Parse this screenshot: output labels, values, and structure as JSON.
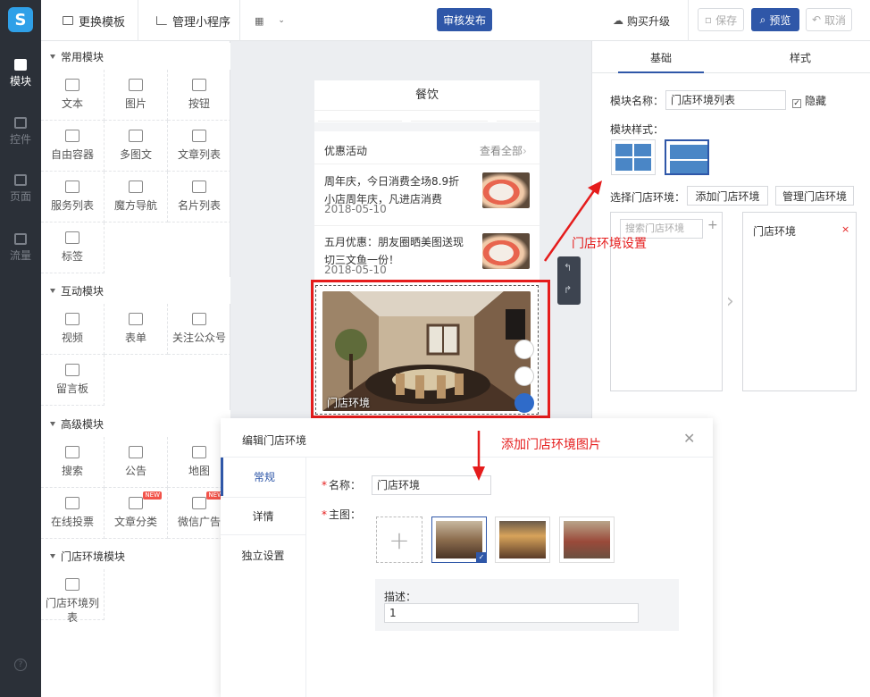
{
  "nav": {
    "logo": "S",
    "items": [
      {
        "label": "模块",
        "icon": "module-icon"
      },
      {
        "label": "控件",
        "icon": "widget-icon"
      },
      {
        "label": "页面",
        "icon": "page-icon"
      },
      {
        "label": "流量",
        "icon": "traffic-icon"
      }
    ],
    "help": "?"
  },
  "topbar": {
    "change_template": "更换模板",
    "manage_miniprogram": "管理小程序",
    "publish": "审核发布",
    "buy_upgrade": "购买升级",
    "save": "保存",
    "preview": "预览",
    "cancel": "取消"
  },
  "modules": {
    "sections": [
      {
        "title": "常用模块",
        "items": [
          "文本",
          "图片",
          "按钮",
          "自由容器",
          "多图文",
          "文章列表",
          "服务列表",
          "魔方导航",
          "名片列表",
          "标签"
        ]
      },
      {
        "title": "互动模块",
        "items": [
          "视频",
          "表单",
          "关注公众号",
          "留言板"
        ]
      },
      {
        "title": "高级模块",
        "items": [
          "搜索",
          "公告",
          "地图",
          "在线投票",
          "文章分类",
          "微信广告"
        ]
      },
      {
        "title": "门店环境模块",
        "items": [
          "门店环境列表"
        ]
      }
    ],
    "new_badge": "NEW"
  },
  "phone": {
    "title": "餐饮",
    "promo_title": "优惠活动",
    "promo_more": "查看全部",
    "news": [
      {
        "title": "周年庆，今日消费全场8.9折 小店周年庆，凡进店消费",
        "date": "2018-05-10"
      },
      {
        "title": "五月优惠：朋友圈晒美图送现切三文鱼一份！",
        "date": "2018-05-10"
      }
    ],
    "env_caption": "门店环境"
  },
  "right": {
    "tabs": [
      "基础",
      "样式"
    ],
    "module_name_label": "模块名称：",
    "module_name_value": "门店环境列表",
    "hide_label": "隐藏",
    "module_style_label": "模块样式：",
    "select_env_label": "选择门店环境：",
    "add_env": "添加门店环境",
    "manage_env": "管理门店环境",
    "search_placeholder": "搜索门店环境",
    "selected_item": "门店环境"
  },
  "annotations": {
    "env_setting": "门店环境设置",
    "add_image": "添加门店环境图片"
  },
  "modal": {
    "title": "编辑门店环境",
    "tabs": [
      "常规",
      "详情",
      "独立设置"
    ],
    "name_label": "名称：",
    "name_value": "门店环境",
    "main_image_label": "主图：",
    "desc_label": "描述：",
    "desc_value": "1"
  },
  "colors": {
    "brand": "#2f57a8",
    "nav_bg": "#2b3038",
    "annotation": "#e51c1c"
  }
}
